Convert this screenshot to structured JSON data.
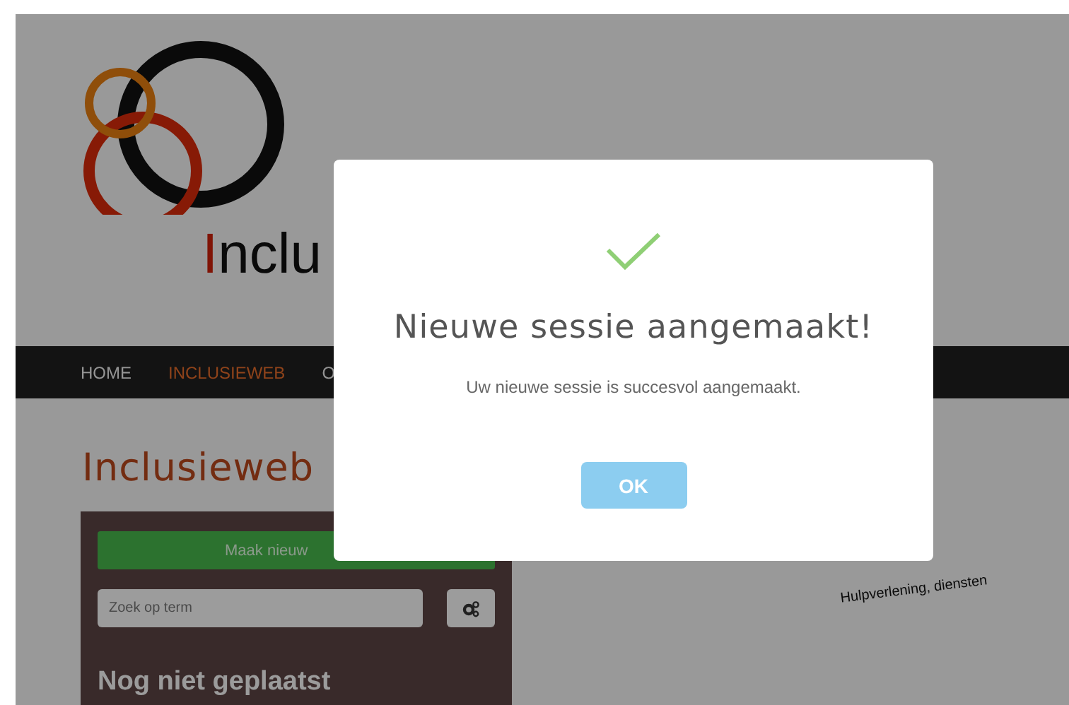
{
  "logo": {
    "initial": "I",
    "rest": "nclu"
  },
  "nav": [
    {
      "label": "HOME",
      "selected": false
    },
    {
      "label": "INCLUSIEWEB",
      "selected": true
    },
    {
      "label": "O",
      "selected": false
    }
  ],
  "heading": "Inclusieweb",
  "panel": {
    "create_button": "Maak nieuw",
    "search": {
      "placeholder": "Zoek op term"
    },
    "section_title": "Nog niet geplaatst"
  },
  "canvas_label": "Hulpverlening, diensten",
  "dialog": {
    "title": "Nieuwe sessie aangemaakt!",
    "message": "Uw nieuwe sessie is succesvol aangemaakt.",
    "button": "OK"
  }
}
